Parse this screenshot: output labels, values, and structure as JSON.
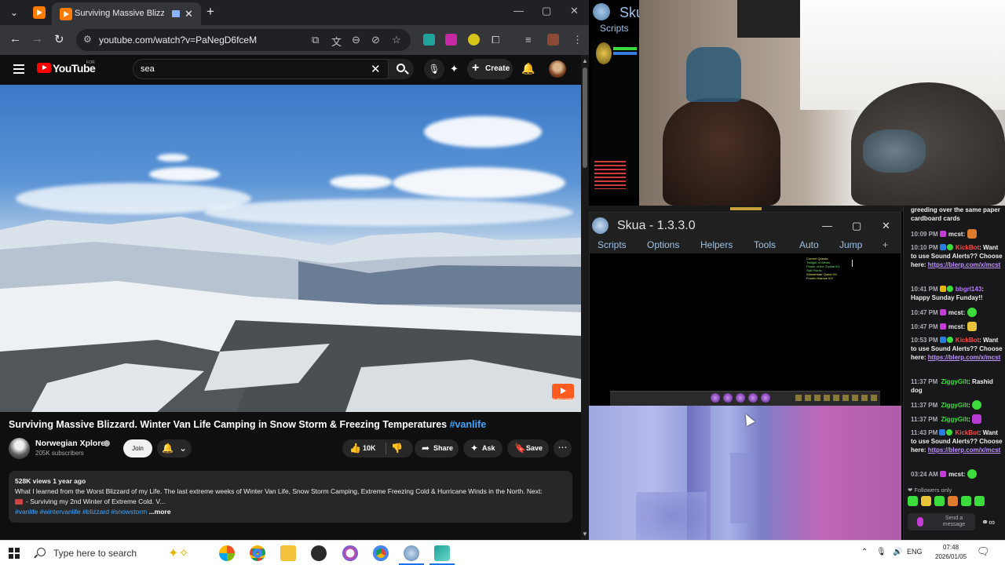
{
  "browser": {
    "tab_title": "Surviving Massive Blizzard.",
    "url": "youtube.com/watch?v=PaNegD6fceM"
  },
  "youtube": {
    "logo_text": "YouTube",
    "logo_sup": "FOR",
    "search_query": "sea",
    "create_label": "Create",
    "video_title": "Surviving Massive Blizzard. Winter Van Life Camping in Snow Storm & Freezing Temperatures",
    "video_hashtag": "#vanlife",
    "channel_name": "Norwegian Xplorer",
    "channel_subs": "205K subscribers",
    "join_label": "Join",
    "like_count": "10K",
    "share_label": "Share",
    "ask_label": "Ask",
    "save_label": "Save",
    "subscribe_badge": "SUBSCRIBE",
    "description": {
      "meta": "528K views  1 year ago",
      "line1": "What I learned from the Worst Blizzard of my Life. The last extreme weeks of Winter Van Life, Snow Storm Camping, Extreme Freezing Cold & Hurricane Winds in the North. Next:",
      "line2": "- Surviving my 2nd Winter of Extreme Cold. V...",
      "tags": "#vanlife #wintervanlife #blizzard #snowstorm",
      "more": "...more"
    }
  },
  "skua_top": {
    "title": "Sku",
    "menu_scripts": "Scripts"
  },
  "skua": {
    "title": "Skua - 1.3.3.0",
    "menu": [
      "Scripts",
      "Options",
      "Helpers",
      "Tools",
      "Auto",
      "Jump",
      "+"
    ],
    "quest_header": "Current Quests:",
    "quest_lines": [
      "Twilight of Winter",
      "Power of the Crystal 0/1",
      "Skill Points",
      "Wonderstar Quest 0/1",
      "Frozen Marrow 0/3"
    ]
  },
  "chat": {
    "top_line": "greeding over the same paper cardboard cards",
    "messages": [
      {
        "time": "10:09 PM",
        "user": "mcst",
        "user_color": "#ffffff",
        "text": ""
      },
      {
        "time": "10:10 PM",
        "user": "KickBot",
        "user_color": "#ff4a4a",
        "text": "Want to use Sound Alerts?? Choose here:",
        "link": "https://blerp.com/x/mcst"
      },
      {
        "time": "10:41 PM",
        "user": "bbgrl143",
        "user_color": "#b47cff",
        "text": "Happy Sunday Funday!!"
      },
      {
        "time": "10:47 PM",
        "user": "mcst",
        "user_color": "#ffffff",
        "text": ""
      },
      {
        "time": "10:47 PM",
        "user": "mcst",
        "user_color": "#ffffff",
        "text": ""
      },
      {
        "time": "10:53 PM",
        "user": "KickBot",
        "user_color": "#ff4a4a",
        "text": "Want to use Sound Alerts?? Choose here:",
        "link": "https://blerp.com/x/mcst"
      },
      {
        "time": "11:37 PM",
        "user": "ZiggyGilt",
        "user_color": "#3ddc3d",
        "text": "Rashid dog"
      },
      {
        "time": "11:37 PM",
        "user": "ZiggyGilt",
        "user_color": "#3ddc3d",
        "text": ""
      },
      {
        "time": "11:37 PM",
        "user": "ZiggyGilt",
        "user_color": "#3ddc3d",
        "text": ""
      },
      {
        "time": "11:43 PM",
        "user": "KickBot",
        "user_color": "#ff4a4a",
        "text": "Want to use Sound Alerts?? Choose here:",
        "link": "https://blerp.com/x/mcst"
      },
      {
        "time": "03:24 AM",
        "user": "mcst",
        "user_color": "#ffffff",
        "text": ""
      }
    ],
    "followers_only": "Followers only",
    "input_placeholder": "Send a message"
  },
  "taskbar": {
    "search_placeholder": "Type here to search",
    "lang": "ENG",
    "time": "07:48",
    "date": "2026/01/05"
  },
  "colors": {
    "youtube_red": "#ff0000",
    "link_blue": "#3ea6ff",
    "twitch_purple": "#bf94ff"
  }
}
